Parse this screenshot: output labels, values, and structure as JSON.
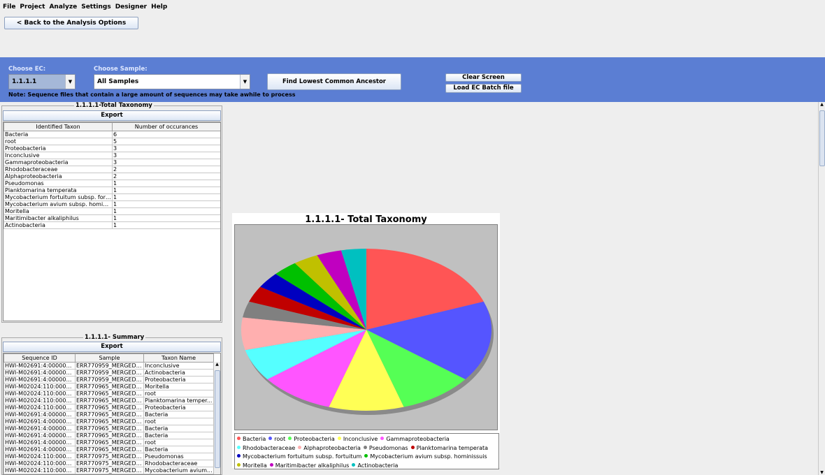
{
  "menu": [
    "File",
    "Project",
    "Analyze",
    "Settings",
    "Designer",
    "Help"
  ],
  "back_button": "< Back to the Analysis Options",
  "toolbar": {
    "choose_ec_label": "Choose EC:",
    "ec_value": "1.1.1.1",
    "choose_sample_label": "Choose Sample:",
    "sample_value": "All Samples",
    "find_lca": "Find Lowest Common Ancestor",
    "clear_screen": "Clear Screen",
    "load_batch": "Load EC Batch file",
    "note": "Note: Sequence files that contain a large amount of sequences may take awhile to process"
  },
  "taxonomy_panel": {
    "title": "1.1.1.1-Total Taxonomy",
    "export": "Export",
    "headers": [
      "Identified Taxon",
      "Number of occurances"
    ],
    "rows": [
      [
        "Bacteria",
        "6"
      ],
      [
        "root",
        "5"
      ],
      [
        "Proteobacteria",
        "3"
      ],
      [
        "Inconclusive",
        "3"
      ],
      [
        "Gammaproteobacteria",
        "3"
      ],
      [
        "Rhodobacteraceae",
        "2"
      ],
      [
        "Alphaproteobacteria",
        "2"
      ],
      [
        "Pseudomonas",
        "1"
      ],
      [
        "Planktomarina temperata",
        "1"
      ],
      [
        "Mycobacterium fortuitum subsp. fort...",
        "1"
      ],
      [
        "Mycobacterium avium subsp. homini...",
        "1"
      ],
      [
        "Moritella",
        "1"
      ],
      [
        "Maritimibacter alkaliphilus",
        "1"
      ],
      [
        "Actinobacteria",
        "1"
      ]
    ]
  },
  "summary_panel": {
    "title": "1.1.1.1- Summary",
    "export": "Export",
    "headers": [
      "Sequence ID",
      "Sample",
      "Taxon Name"
    ],
    "rows": [
      [
        "HWI-M02691:4:000000...",
        "ERR770959_MERGED_...",
        "Inconclusive"
      ],
      [
        "HWI-M02691:4:000000...",
        "ERR770959_MERGED_...",
        "Actinobacteria"
      ],
      [
        "HWI-M02691:4:000000...",
        "ERR770959_MERGED_...",
        "Proteobacteria"
      ],
      [
        "HWI-M02024:110:0000...",
        "ERR770965_MERGED_...",
        "Moritella"
      ],
      [
        "HWI-M02024:110:0000...",
        "ERR770965_MERGED_...",
        "root"
      ],
      [
        "HWI-M02024:110:0000...",
        "ERR770965_MERGED_...",
        "Planktomarina temper..."
      ],
      [
        "HWI-M02024:110:0000...",
        "ERR770965_MERGED_...",
        "Proteobacteria"
      ],
      [
        "HWI-M02691:4:000000...",
        "ERR770965_MERGED_...",
        "Bacteria"
      ],
      [
        "HWI-M02691:4:000000...",
        "ERR770965_MERGED_...",
        "root"
      ],
      [
        "HWI-M02691:4:000000...",
        "ERR770965_MERGED_...",
        "Bacteria"
      ],
      [
        "HWI-M02691:4:000000...",
        "ERR770965_MERGED_...",
        "Bacteria"
      ],
      [
        "HWI-M02691:4:000000...",
        "ERR770965_MERGED_...",
        "root"
      ],
      [
        "HWI-M02691:4:000000...",
        "ERR770965_MERGED_...",
        "Bacteria"
      ],
      [
        "HWI-M02024:110:0000...",
        "ERR770975_MERGED_...",
        "Pseudomonas"
      ],
      [
        "HWI-M02024:110:0000...",
        "ERR770975_MERGED_...",
        "Rhodobacteraceae"
      ],
      [
        "HWI-M02024:110:0000...",
        "ERR770975_MERGED_...",
        "Mycobacterium avium..."
      ]
    ]
  },
  "chart_data": {
    "type": "pie",
    "title": "1.1.1.1- Total Taxonomy",
    "categories": [
      "Bacteria",
      "root",
      "Proteobacteria",
      "Inconclusive",
      "Gammaproteobacteria",
      "Rhodobacteraceae",
      "Alphaproteobacteria",
      "Pseudomonas",
      "Planktomarina temperata",
      "Mycobacterium fortuitum subsp. fortuitum",
      "Mycobacterium avium subsp. hominissuis",
      "Moritella",
      "Maritimibacter alkaliphilus",
      "Actinobacteria"
    ],
    "values": [
      6,
      5,
      3,
      3,
      3,
      2,
      2,
      1,
      1,
      1,
      1,
      1,
      1,
      1
    ],
    "colors": [
      "#ff5555",
      "#5555ff",
      "#55ff55",
      "#ffff55",
      "#ff55ff",
      "#55ffff",
      "#ffafaf",
      "#808080",
      "#c00000",
      "#0000c0",
      "#00c000",
      "#c0c000",
      "#c000c0",
      "#00c0c0"
    ],
    "legend_position": "bottom"
  }
}
